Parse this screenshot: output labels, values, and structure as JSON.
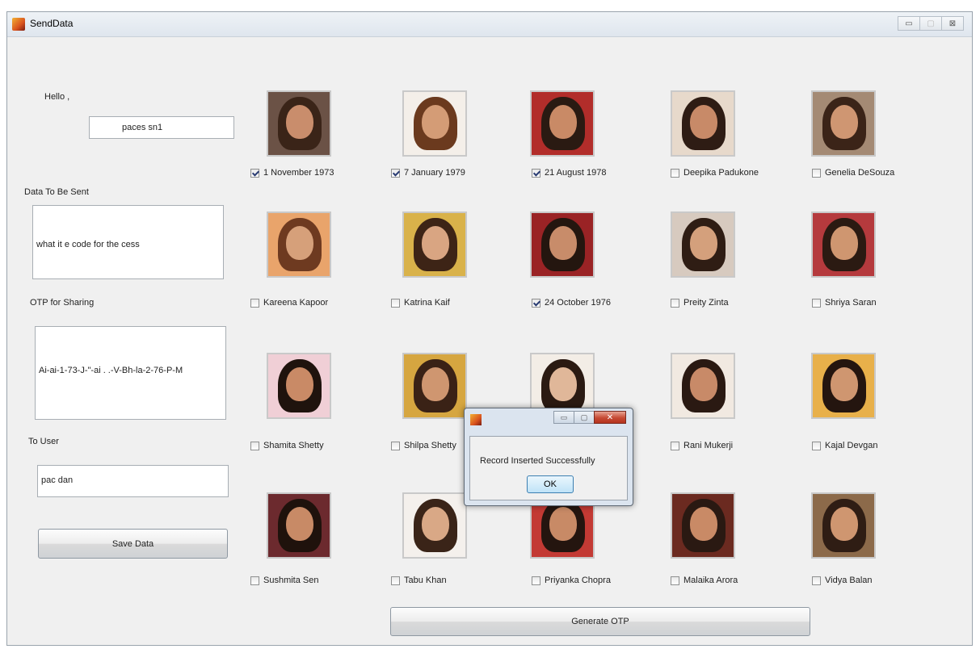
{
  "window": {
    "title": "SendData",
    "controls": {
      "minimize": "▭",
      "maximize": "▢",
      "close": "⊠"
    }
  },
  "left_panel": {
    "hello_label": "Hello ,",
    "username_value": "paces  sn1",
    "data_label": "Data To Be Sent",
    "data_value": "what it  e code for the   cess",
    "otp_label": "OTP for Sharing",
    "otp_value": "Ai-ai-1-73-J-\"-ai   . .-V-Bh-la-2-76-P-M",
    "to_user_label": "To User",
    "to_user_value": "pac  dan",
    "save_button": "Save Data"
  },
  "grid": [
    {
      "label": "1 November 1973",
      "checked": true,
      "skin": "#c98d6c",
      "hair": "#3a2418",
      "bg": "#6b5246"
    },
    {
      "label": "7 January 1979",
      "checked": true,
      "skin": "#d49c76",
      "hair": "#6b3a1e",
      "bg": "#f4efe9"
    },
    {
      "label": "21 August 1978",
      "checked": true,
      "skin": "#c98a66",
      "hair": "#2a1a12",
      "bg": "#b22d2a"
    },
    {
      "label": "Deepika Padukone",
      "checked": false,
      "skin": "#c88a68",
      "hair": "#2e1c14",
      "bg": "#e7d9cb"
    },
    {
      "label": "Genelia DeSouza",
      "checked": false,
      "skin": "#cf9672",
      "hair": "#3b2418",
      "bg": "#a48a74"
    },
    {
      "label": "Kareena Kapoor",
      "checked": false,
      "skin": "#d6a07a",
      "hair": "#6e3a20",
      "bg": "#e9a46b"
    },
    {
      "label": "Katrina Kaif",
      "checked": false,
      "skin": "#d9a582",
      "hair": "#3d2416",
      "bg": "#d9b24a"
    },
    {
      "label": "24 October 1976",
      "checked": true,
      "skin": "#c88c6a",
      "hair": "#24160f",
      "bg": "#9a2325"
    },
    {
      "label": "Preity Zinta",
      "checked": false,
      "skin": "#d4a07c",
      "hair": "#2f1d14",
      "bg": "#d7cabf"
    },
    {
      "label": "Shriya Saran",
      "checked": false,
      "skin": "#cf9670",
      "hair": "#2b1a12",
      "bg": "#b53a3d"
    },
    {
      "label": "Shamita Shetty",
      "checked": false,
      "skin": "#c98a66",
      "hair": "#1f130d",
      "bg": "#f0cfd6"
    },
    {
      "label": "Shilpa Shetty",
      "checked": false,
      "skin": "#cf9670",
      "hair": "#3a2216",
      "bg": "#d6a640"
    },
    {
      "label": "",
      "checked": false,
      "skin": "#e0b799",
      "hair": "#2b1a12",
      "bg": "#f3ede6"
    },
    {
      "label": "Rani Mukerji",
      "checked": false,
      "skin": "#c88a68",
      "hair": "#2a1912",
      "bg": "#f1e9e1"
    },
    {
      "label": "Kajal Devgan",
      "checked": false,
      "skin": "#cf9670",
      "hair": "#24150f",
      "bg": "#e8b04a"
    },
    {
      "label": "Sushmita Sen",
      "checked": false,
      "skin": "#c88a66",
      "hair": "#1f120c",
      "bg": "#6c2a2e"
    },
    {
      "label": "Tabu Khan",
      "checked": false,
      "skin": "#d9a886",
      "hair": "#3a2418",
      "bg": "#f4f0ec"
    },
    {
      "label": "Priyanka Chopra",
      "checked": false,
      "skin": "#c88a66",
      "hair": "#24150f",
      "bg": "#c33a34"
    },
    {
      "label": "Malaika Arora",
      "checked": false,
      "skin": "#c98a66",
      "hair": "#2a1912",
      "bg": "#6b2a20"
    },
    {
      "label": "Vidya Balan",
      "checked": false,
      "skin": "#cf9670",
      "hair": "#2f1d14",
      "bg": "#8c6a4a"
    }
  ],
  "generate_button": "Generate OTP",
  "dialog": {
    "message": "Record Inserted Successfully",
    "ok": "OK",
    "close_glyph": "✕",
    "min_glyph": "▭",
    "max_glyph": "▢"
  }
}
